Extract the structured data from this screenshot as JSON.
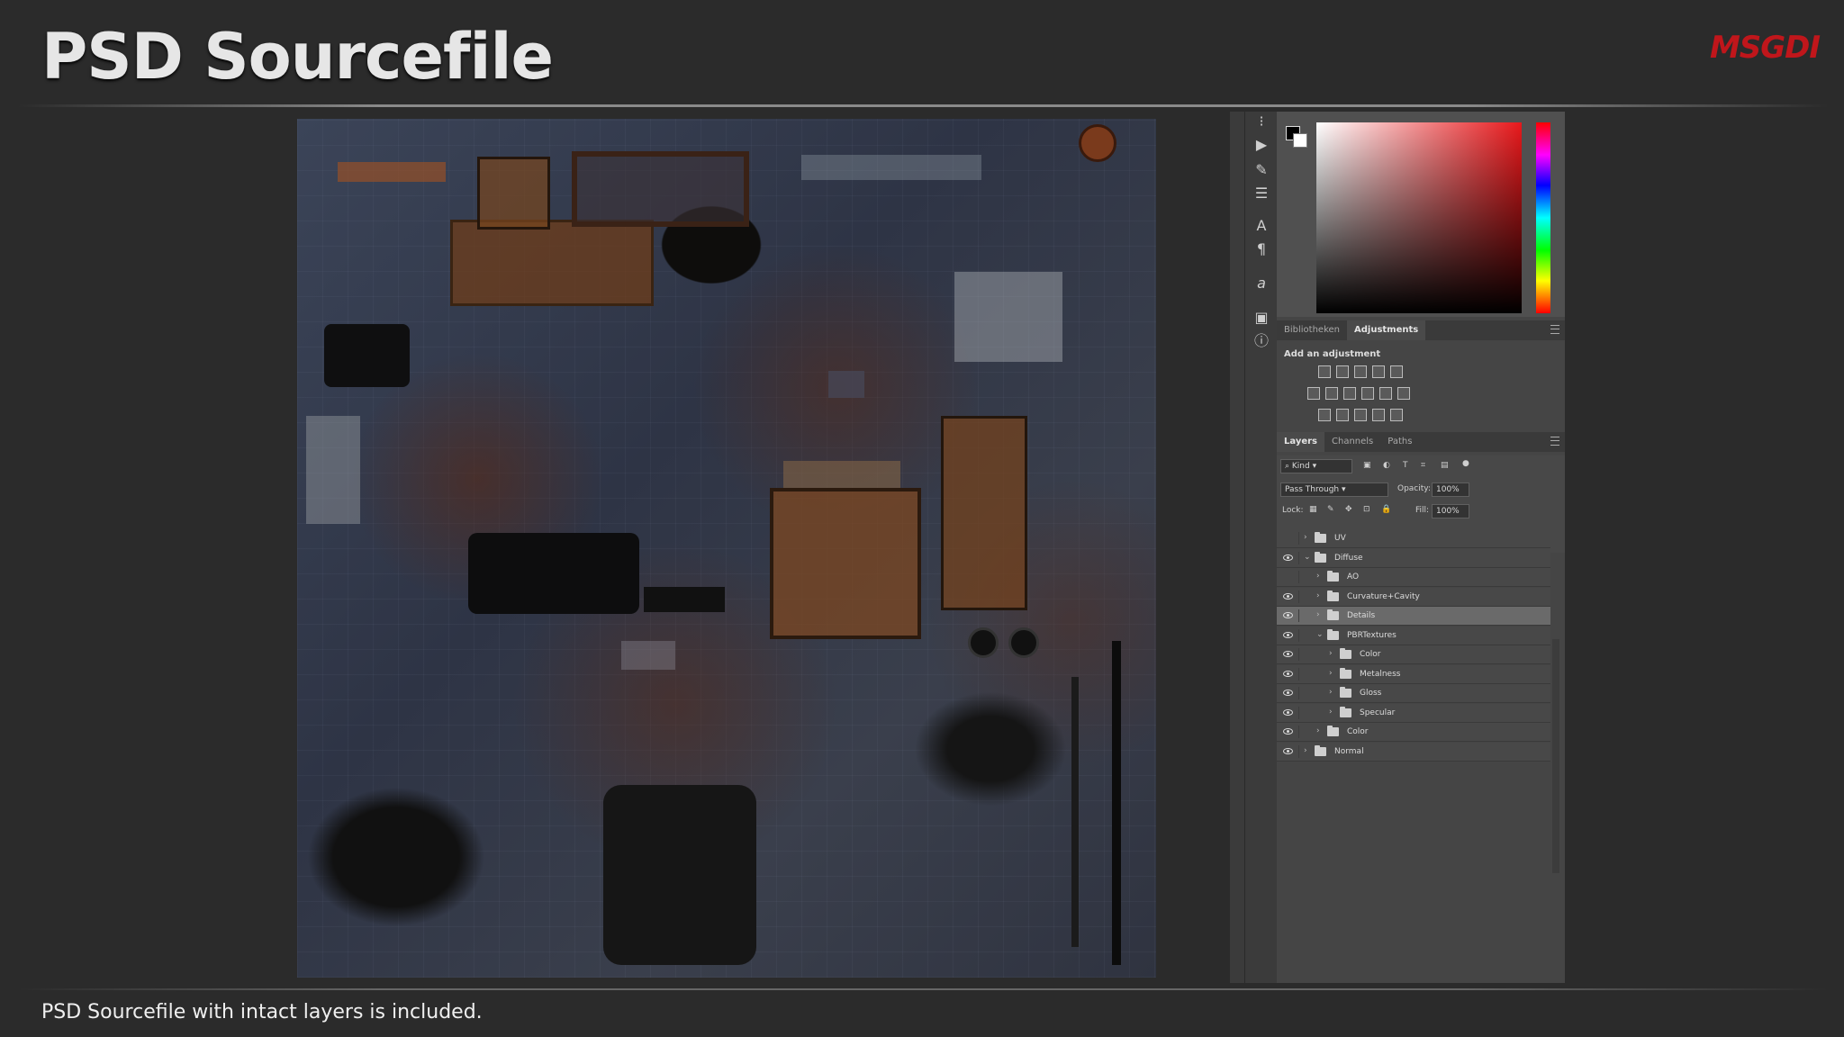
{
  "slide": {
    "title": "PSD Sourcefile",
    "logo_text": "MSGDI",
    "caption": "PSD Sourcefile with intact layers is included."
  },
  "photoshop": {
    "foreground_color": "#000000",
    "background_color": "#ffffff",
    "picker_hue_color": "#e8181b",
    "panel_tabs": [
      {
        "label": "Bibliotheken",
        "active": false
      },
      {
        "label": "Adjustments",
        "active": true
      }
    ],
    "adjustments_title": "Add an adjustment",
    "layers_tabs": [
      {
        "label": "Layers",
        "active": true
      },
      {
        "label": "Channels",
        "active": false
      },
      {
        "label": "Paths",
        "active": false
      }
    ],
    "filter_kind": "Kind",
    "blend_mode": "Pass Through",
    "opacity_label": "Opacity:",
    "opacity_value": "100%",
    "lock_label": "Lock:",
    "fill_label": "Fill:",
    "fill_value": "100%",
    "layers": [
      {
        "name": "UV",
        "visible": false,
        "expanded": false,
        "depth": 0,
        "selected": false
      },
      {
        "name": "Diffuse",
        "visible": true,
        "expanded": true,
        "depth": 0,
        "selected": false
      },
      {
        "name": "AO",
        "visible": false,
        "expanded": false,
        "depth": 1,
        "selected": false
      },
      {
        "name": "Curvature+Cavity",
        "visible": true,
        "expanded": false,
        "depth": 1,
        "selected": false
      },
      {
        "name": "Details",
        "visible": true,
        "expanded": false,
        "depth": 1,
        "selected": true
      },
      {
        "name": "PBRTextures",
        "visible": true,
        "expanded": true,
        "depth": 1,
        "selected": false
      },
      {
        "name": "Color",
        "visible": true,
        "expanded": false,
        "depth": 2,
        "selected": false
      },
      {
        "name": "Metalness",
        "visible": true,
        "expanded": false,
        "depth": 2,
        "selected": false
      },
      {
        "name": "Gloss",
        "visible": true,
        "expanded": false,
        "depth": 2,
        "selected": false
      },
      {
        "name": "Specular",
        "visible": true,
        "expanded": false,
        "depth": 2,
        "selected": false
      },
      {
        "name": "Color",
        "visible": true,
        "expanded": false,
        "depth": 1,
        "selected": false
      },
      {
        "name": "Normal",
        "visible": true,
        "expanded": false,
        "depth": 0,
        "selected": false
      }
    ],
    "tools": [
      "brush-history-icon",
      "play-icon",
      "brush-settings-icon",
      "sliders-icon",
      "character-icon",
      "paragraph-icon",
      "glyphs-icon",
      "properties-icon",
      "info-icon"
    ]
  }
}
